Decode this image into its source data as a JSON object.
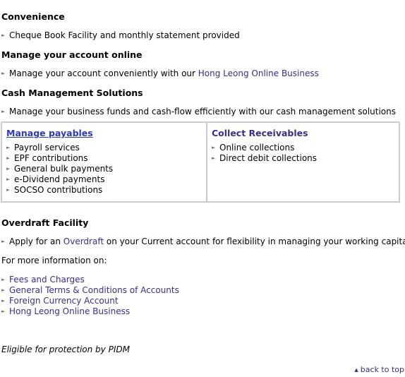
{
  "convenience": {
    "heading": "Convenience",
    "items": [
      "Cheque Book Facility and monthly statement provided"
    ]
  },
  "online": {
    "heading": "Manage your account online",
    "text": "Manage your account conveniently with our ",
    "link": "Hong Leong Online Business"
  },
  "cash_management": {
    "heading": "Cash Management Solutions",
    "text": "Manage your business funds and cash-flow efficiently with our cash management solutions",
    "payables": {
      "title": "Manage payables",
      "items": [
        "Payroll services",
        "EPF contributions",
        "General bulk payments",
        "e-Dividend payments",
        "SOCSO contributions"
      ]
    },
    "receivables": {
      "title": "Collect Receivables",
      "items": [
        "Online collections",
        "Direct debit collections"
      ]
    }
  },
  "overdraft": {
    "heading": "Overdraft Facility",
    "text_before": "Apply for an ",
    "link": "Overdraft",
    "text_after": " on your Current account for flexibility in managing your working capital"
  },
  "more_info": {
    "label": "For more information on:",
    "links": [
      "Fees and Charges",
      "General Terms & Conditions of Accounts",
      "Foreign Currency Account",
      "Hong Leong Online Business"
    ]
  },
  "footer": {
    "pidm": "Eligible for protection by PIDM",
    "back_to_top": "back to top"
  },
  "colors": {
    "link": "#3b2e8a",
    "link_underlined": "#2c3ab8",
    "border": "#cccccc"
  }
}
